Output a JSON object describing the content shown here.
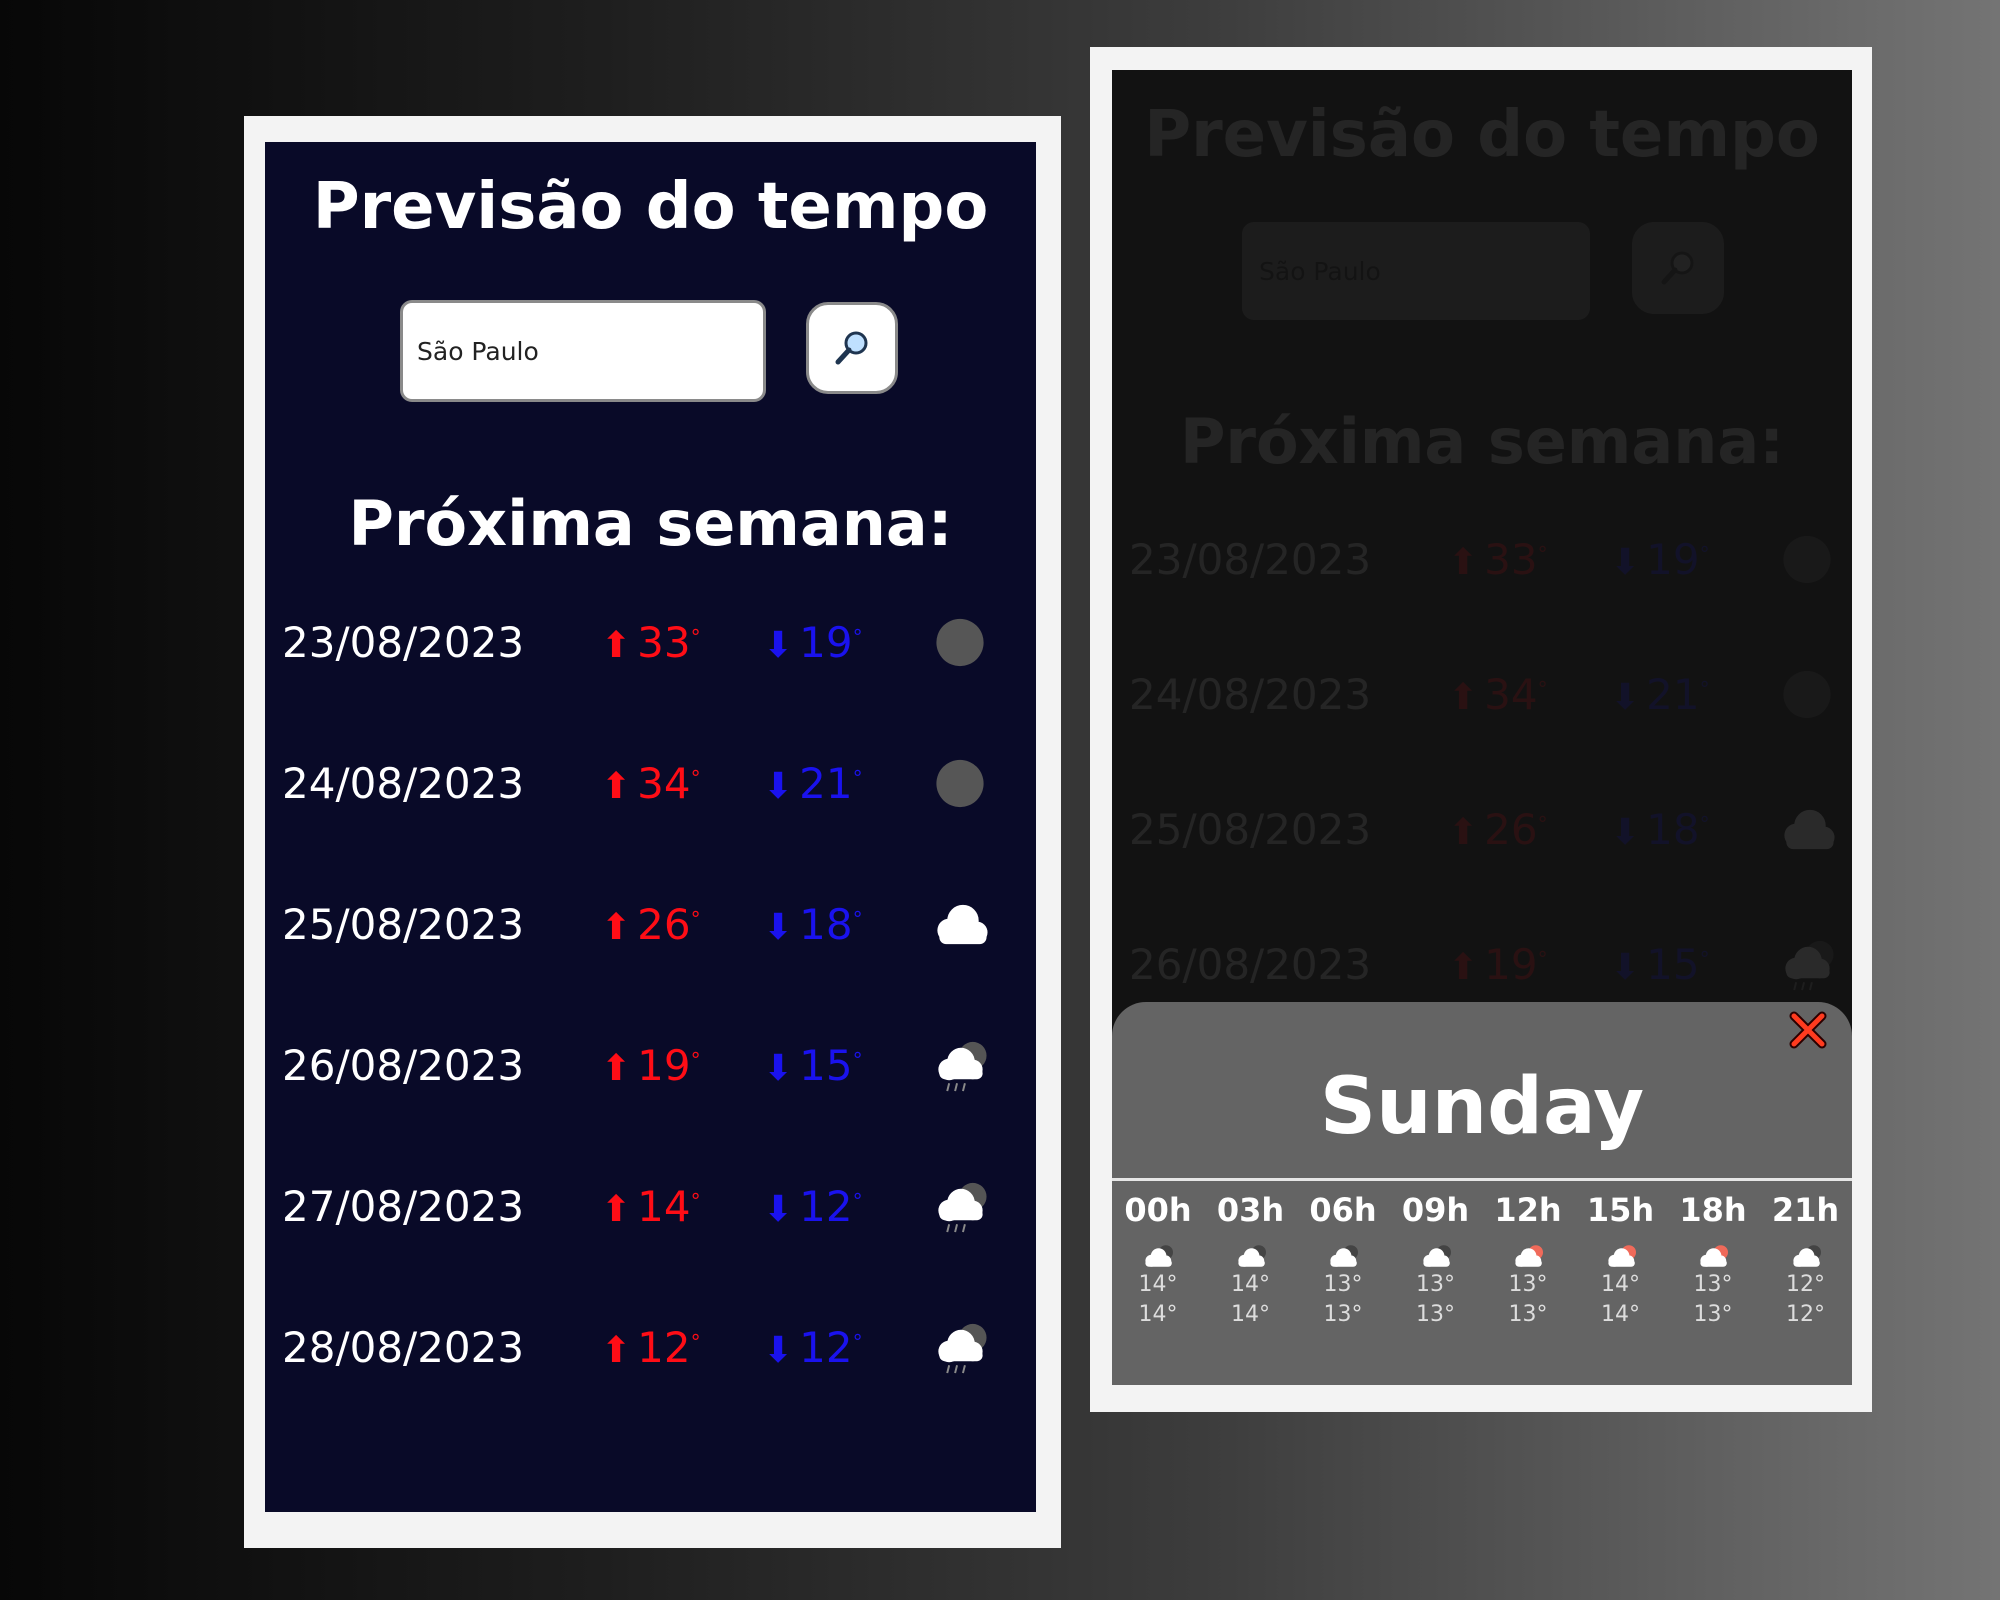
{
  "app": {
    "title": "Previsão do tempo",
    "search": {
      "value": "São Paulo",
      "placeholder": "São Paulo"
    },
    "week_heading": "Próxima semana:",
    "colors": {
      "max_temp": "#ff0d16",
      "min_temp": "#1a12ee",
      "background": "#090a28"
    }
  },
  "forecast": [
    {
      "date": "23/08/2023",
      "max": "33",
      "min": "19",
      "icon": "moon-icon"
    },
    {
      "date": "24/08/2023",
      "max": "34",
      "min": "21",
      "icon": "moon-icon"
    },
    {
      "date": "25/08/2023",
      "max": "26",
      "min": "18",
      "icon": "cloud-icon"
    },
    {
      "date": "26/08/2023",
      "max": "19",
      "min": "15",
      "icon": "cloud-rain-icon"
    },
    {
      "date": "27/08/2023",
      "max": "14",
      "min": "12",
      "icon": "cloud-rain-icon"
    },
    {
      "date": "28/08/2023",
      "max": "12",
      "min": "12",
      "icon": "cloud-rain-icon"
    }
  ],
  "modal": {
    "day": "Sunday",
    "close_icon": "close-icon",
    "hours": [
      {
        "label": "00h",
        "temp1": "14°",
        "temp2": "14°",
        "icon": "cloud-moon-icon"
      },
      {
        "label": "03h",
        "temp1": "14°",
        "temp2": "14°",
        "icon": "cloud-moon-icon"
      },
      {
        "label": "06h",
        "temp1": "13°",
        "temp2": "13°",
        "icon": "cloud-moon-icon"
      },
      {
        "label": "09h",
        "temp1": "13°",
        "temp2": "13°",
        "icon": "cloud-moon-icon"
      },
      {
        "label": "12h",
        "temp1": "13°",
        "temp2": "13°",
        "icon": "cloud-sun-icon"
      },
      {
        "label": "15h",
        "temp1": "14°",
        "temp2": "14°",
        "icon": "cloud-sun-icon"
      },
      {
        "label": "18h",
        "temp1": "13°",
        "temp2": "13°",
        "icon": "cloud-sun-icon"
      },
      {
        "label": "21h",
        "temp1": "12°",
        "temp2": "12°",
        "icon": "cloud-moon-icon"
      }
    ]
  }
}
